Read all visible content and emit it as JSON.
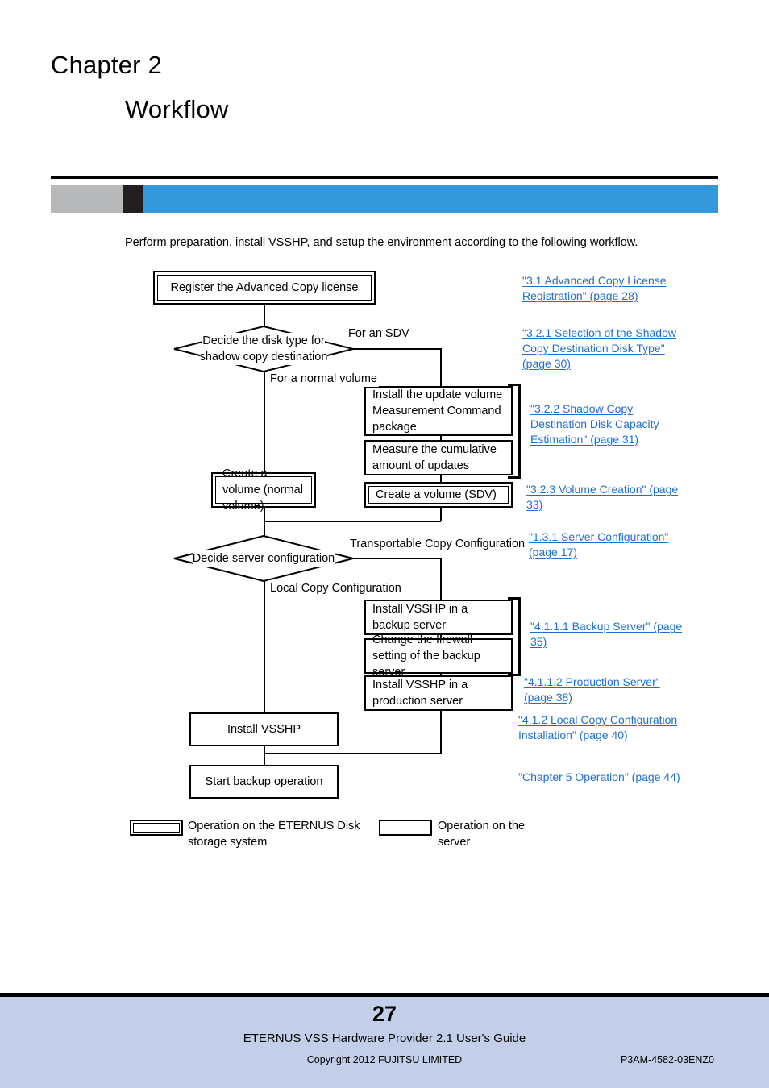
{
  "page": {
    "chapter_label": "Chapter 2",
    "chapter_title": "Workflow",
    "intro": "Perform preparation, install VSSHP, and setup the environment according to the following workflow.",
    "accent_blue": "#3498db",
    "accent_grey": "#b6b8ba",
    "accent_black": "#231f20",
    "link_color": "#1f6fd0",
    "footer_bg": "#c3cfe8"
  },
  "flowchart": {
    "nodes": [
      {
        "id": "register-license",
        "label": "Register the Advanced Copy license",
        "kind": "eternus"
      },
      {
        "id": "install-measurement-command",
        "label": "Install the update volume Measurement Command package",
        "kind": "server"
      },
      {
        "id": "measure-cumulative-updates",
        "label": "Measure the cumulative amount of updates",
        "kind": "server"
      },
      {
        "id": "create-volume-normal",
        "label": "Create a volume (normal volume)",
        "kind": "eternus"
      },
      {
        "id": "create-volume-sdv",
        "label": "Create a volume (SDV)",
        "kind": "eternus"
      },
      {
        "id": "install-vsshp-backup-server",
        "label": "Install VSSHP in a backup server",
        "kind": "server"
      },
      {
        "id": "change-firewall-setting",
        "label": "Change the firewall setting of the backup server",
        "kind": "server"
      },
      {
        "id": "install-vsshp-production-server",
        "label": "Install VSSHP in a production server",
        "kind": "server"
      },
      {
        "id": "install-vsshp",
        "label": "Install VSSHP",
        "kind": "server"
      },
      {
        "id": "start-backup-operation",
        "label": "Start backup operation",
        "kind": "server"
      }
    ],
    "decisions": [
      {
        "id": "decide-disk-type",
        "line1": "Decide the disk type for",
        "line2": "shadow copy destination"
      },
      {
        "id": "decide-server-configuration",
        "line1": "Decide server configuration",
        "line2": ""
      }
    ],
    "edge_labels": {
      "for_an_sdv": "For an SDV",
      "for_a_normal_volume": "For a normal volume",
      "transportable_copy_configuration": "Transportable Copy Configuration",
      "local_copy_configuration": "Local Copy Configuration"
    }
  },
  "xrefs": [
    {
      "id": "xref-3-1",
      "text": "\"3.1 Advanced Copy License Registration\" (page 28)"
    },
    {
      "id": "xref-3-2-1",
      "text": "\"3.2.1 Selection of the Shadow Copy Destination Disk Type\" (page 30)"
    },
    {
      "id": "xref-3-2-2",
      "text": "\"3.2.2 Shadow Copy Destination Disk Capacity Estimation\" (page 31)"
    },
    {
      "id": "xref-3-2-3",
      "text": "\"3.2.3 Volume Creation\" (page 33)"
    },
    {
      "id": "xref-1-3-1",
      "text": "\"1.3.1 Server Configuration\" (page 17)"
    },
    {
      "id": "xref-4-1-1-1",
      "text": "\"4.1.1.1 Backup Server\" (page 35)"
    },
    {
      "id": "xref-4-1-1-2",
      "text": "\"4.1.1.2 Production Server\" (page 38)"
    },
    {
      "id": "xref-4-1-2",
      "text": "\"4.1.2 Local Copy Configuration Installation\" (page 40)"
    },
    {
      "id": "xref-chapter-5",
      "text": "\"Chapter 5 Operation\" (page 44)"
    }
  ],
  "legend": {
    "eternus": "Operation on the ETERNUS Disk storage system",
    "server": "Operation on the server"
  },
  "footer": {
    "page_number": "27",
    "guide": "ETERNUS VSS Hardware Provider 2.1 User's Guide",
    "copyright": "Copyright 2012 FUJITSU LIMITED",
    "document_id": "P3AM-4582-03ENZ0"
  }
}
